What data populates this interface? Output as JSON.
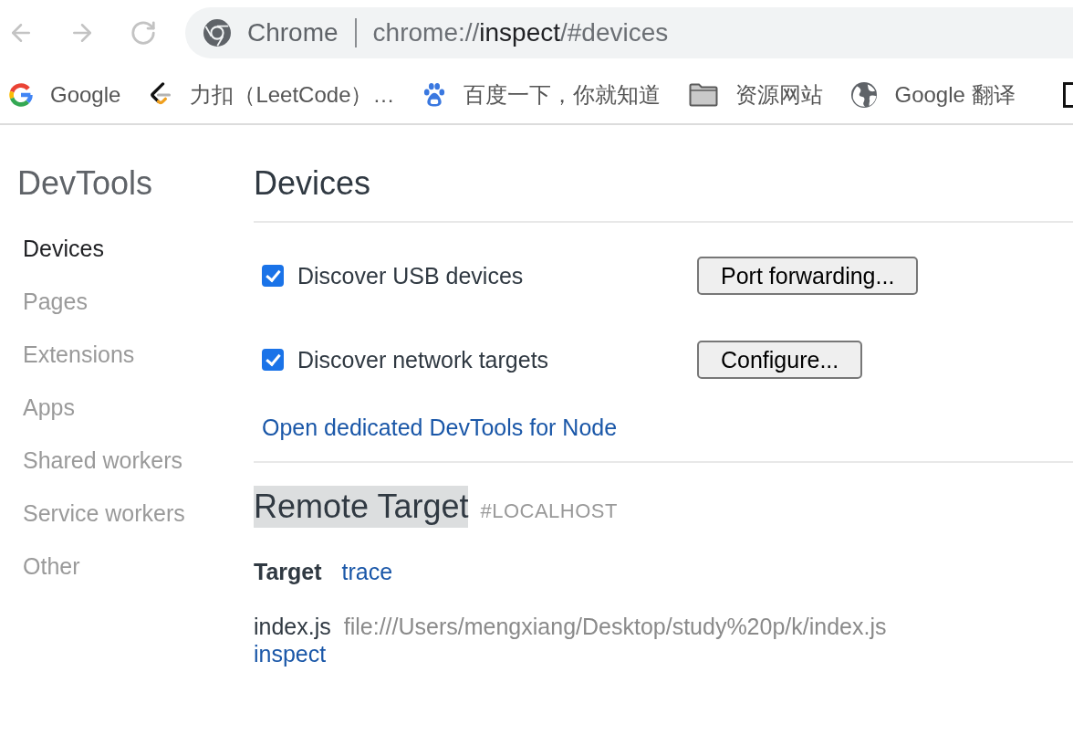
{
  "toolbar": {
    "site_label": "Chrome",
    "url": {
      "scheme": "chrome://",
      "host": "inspect",
      "path": "/#devices"
    }
  },
  "bookmarks": [
    {
      "kind": "g-logo",
      "label": "Google"
    },
    {
      "kind": "bracket",
      "label": "力扣（LeetCode）…"
    },
    {
      "kind": "paw",
      "label": "百度一下，你就知道"
    },
    {
      "kind": "folder",
      "label": "资源网站"
    },
    {
      "kind": "globe",
      "label": "Google 翻译"
    },
    {
      "kind": "square"
    }
  ],
  "sidebar": {
    "title": "DevTools",
    "items": [
      {
        "label": "Devices",
        "selected": true
      },
      {
        "label": "Pages",
        "selected": false
      },
      {
        "label": "Extensions",
        "selected": false
      },
      {
        "label": "Apps",
        "selected": false
      },
      {
        "label": "Shared workers",
        "selected": false
      },
      {
        "label": "Service workers",
        "selected": false
      },
      {
        "label": "Other",
        "selected": false
      }
    ]
  },
  "devices": {
    "title": "Devices",
    "options": [
      {
        "label": "Discover USB devices",
        "checked": true,
        "button": "Port forwarding..."
      },
      {
        "label": "Discover network targets",
        "checked": true,
        "button": "Configure..."
      }
    ],
    "node_link": "Open dedicated DevTools for Node"
  },
  "remote_target": {
    "title": "Remote Target",
    "highlighted": true,
    "host": "#LOCALHOST",
    "column_label": "Target",
    "column_action": "trace",
    "targets": [
      {
        "name": "index.js",
        "url": "file:///Users/mengxiang/Desktop/study%20p/k/index.js",
        "action": "inspect"
      }
    ]
  }
}
